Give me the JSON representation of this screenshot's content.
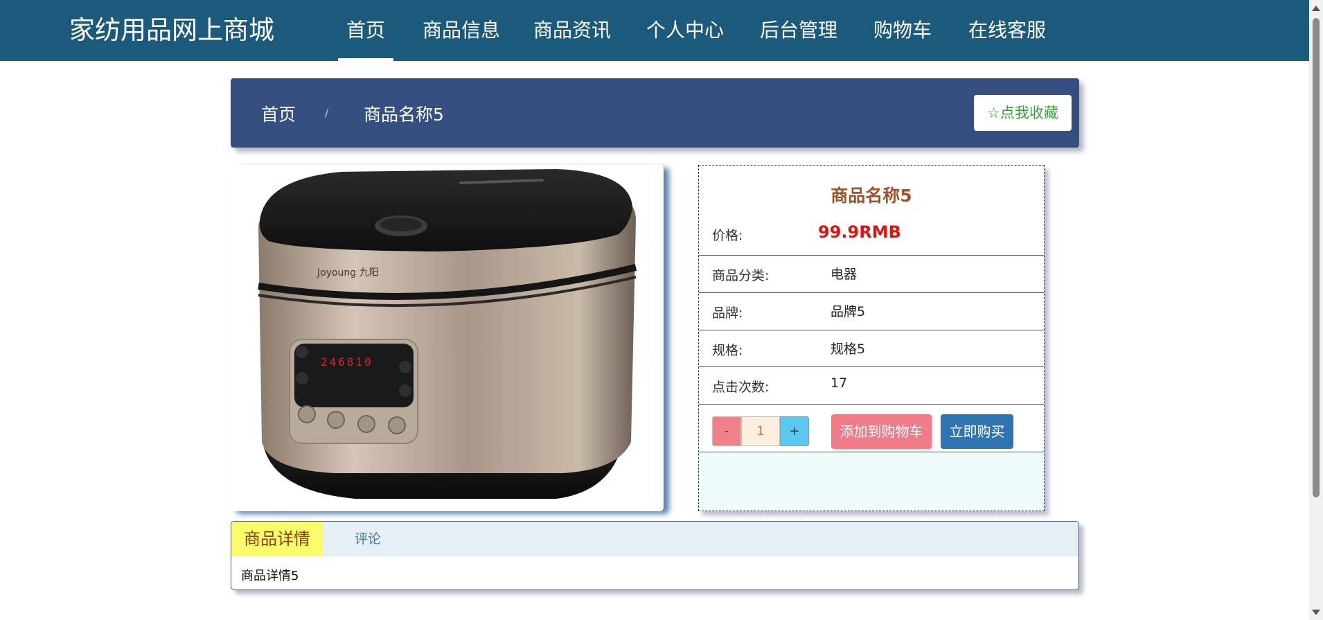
{
  "site": {
    "title": "家纺用品网上商城"
  },
  "nav": {
    "items": [
      {
        "label": "首页",
        "active": true
      },
      {
        "label": "商品信息"
      },
      {
        "label": "商品资讯"
      },
      {
        "label": "个人中心"
      },
      {
        "label": "后台管理"
      },
      {
        "label": "购物车"
      },
      {
        "label": "在线客服"
      }
    ]
  },
  "breadcrumb": {
    "home": "首页",
    "separator": "/",
    "current": "商品名称5"
  },
  "favorite": {
    "icon": "star-outline-icon",
    "label": "点我收藏"
  },
  "product": {
    "image_alt": "product-image-rice-cooker",
    "name": "商品名称5",
    "price_label": "价格:",
    "price_value": "99.9RMB",
    "category_label": "商品分类:",
    "category_value": "电器",
    "brand_label": "品牌:",
    "brand_value": "品牌5",
    "spec_label": "规格:",
    "spec_value": "规格5",
    "clicks_label": "点击次数:",
    "clicks_value": "17"
  },
  "purchase": {
    "minus": "-",
    "quantity": "1",
    "plus": "+",
    "add_to_cart": "添加到购物车",
    "buy_now": "立即购买"
  },
  "tabs": {
    "details": "商品详情",
    "comments": "评论",
    "content": "商品详情5"
  },
  "colors": {
    "nav_bg": "#1c5a7c",
    "breadcrumb_bg": "#344f80",
    "price": "#e0140f",
    "title": "#a0522d",
    "add_cart_bg": "#ee7b87",
    "buy_now_bg": "#2f73b0",
    "tab_active_bg": "#fafa6a"
  },
  "rice_cooker_display": {
    "digits": "246810",
    "brand_marking": "Joyoung 九阳"
  }
}
